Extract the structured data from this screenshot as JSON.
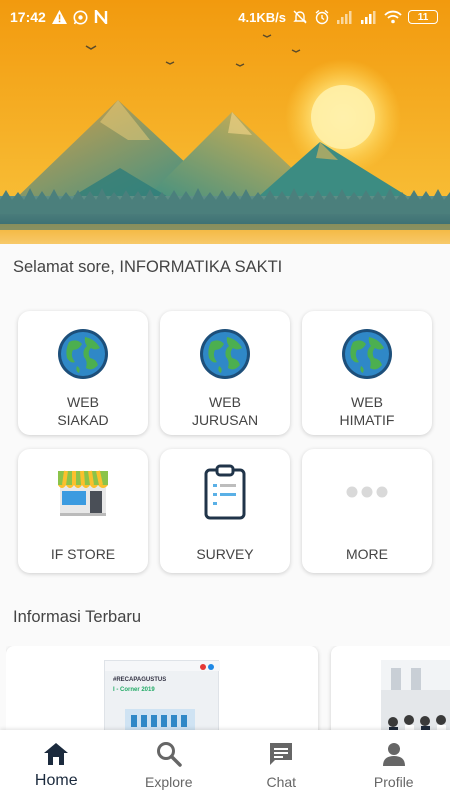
{
  "status_bar": {
    "time": "17:42",
    "network_speed": "4.1KB/s",
    "battery": "11",
    "icons": [
      "warning-icon",
      "whatsapp-icon",
      "n-app-icon",
      "mute-icon",
      "alarm-icon",
      "signal-icon",
      "signal-icon",
      "wifi-icon",
      "battery-icon"
    ]
  },
  "greeting": "Selamat sore, INFORMATIKA SAKTI",
  "menu": {
    "items": [
      {
        "label": "WEB\nSIAKAD",
        "icon": "globe-icon"
      },
      {
        "label": "WEB\nJURUSAN",
        "icon": "globe-icon"
      },
      {
        "label": "WEB\nHIMATIF",
        "icon": "globe-icon"
      },
      {
        "label": "IF STORE",
        "icon": "store-icon"
      },
      {
        "label": "SURVEY",
        "icon": "clipboard-icon"
      },
      {
        "label": "MORE",
        "icon": "more-dots-icon"
      }
    ]
  },
  "news_section": {
    "title": "Informasi Terbaru",
    "cards": [
      {
        "thumb_text_1": "#RECAPAGUSTUS",
        "thumb_text_2": "I - Corner 2019"
      },
      {
        "thumb_text_1": "",
        "thumb_text_2": ""
      }
    ]
  },
  "bottom_nav": {
    "items": [
      {
        "label": "Home",
        "icon": "home-icon",
        "active": true
      },
      {
        "label": "Explore",
        "icon": "search-icon",
        "active": false
      },
      {
        "label": "Chat",
        "icon": "chat-icon",
        "active": false
      },
      {
        "label": "Profile",
        "icon": "profile-icon",
        "active": false
      }
    ]
  },
  "colors": {
    "sky_top": "#f59e0b",
    "sky_bottom": "#f8c242",
    "accent_dark": "#1b2a3d",
    "globe_ocean": "#2f88c7",
    "globe_land": "#4caf50"
  }
}
